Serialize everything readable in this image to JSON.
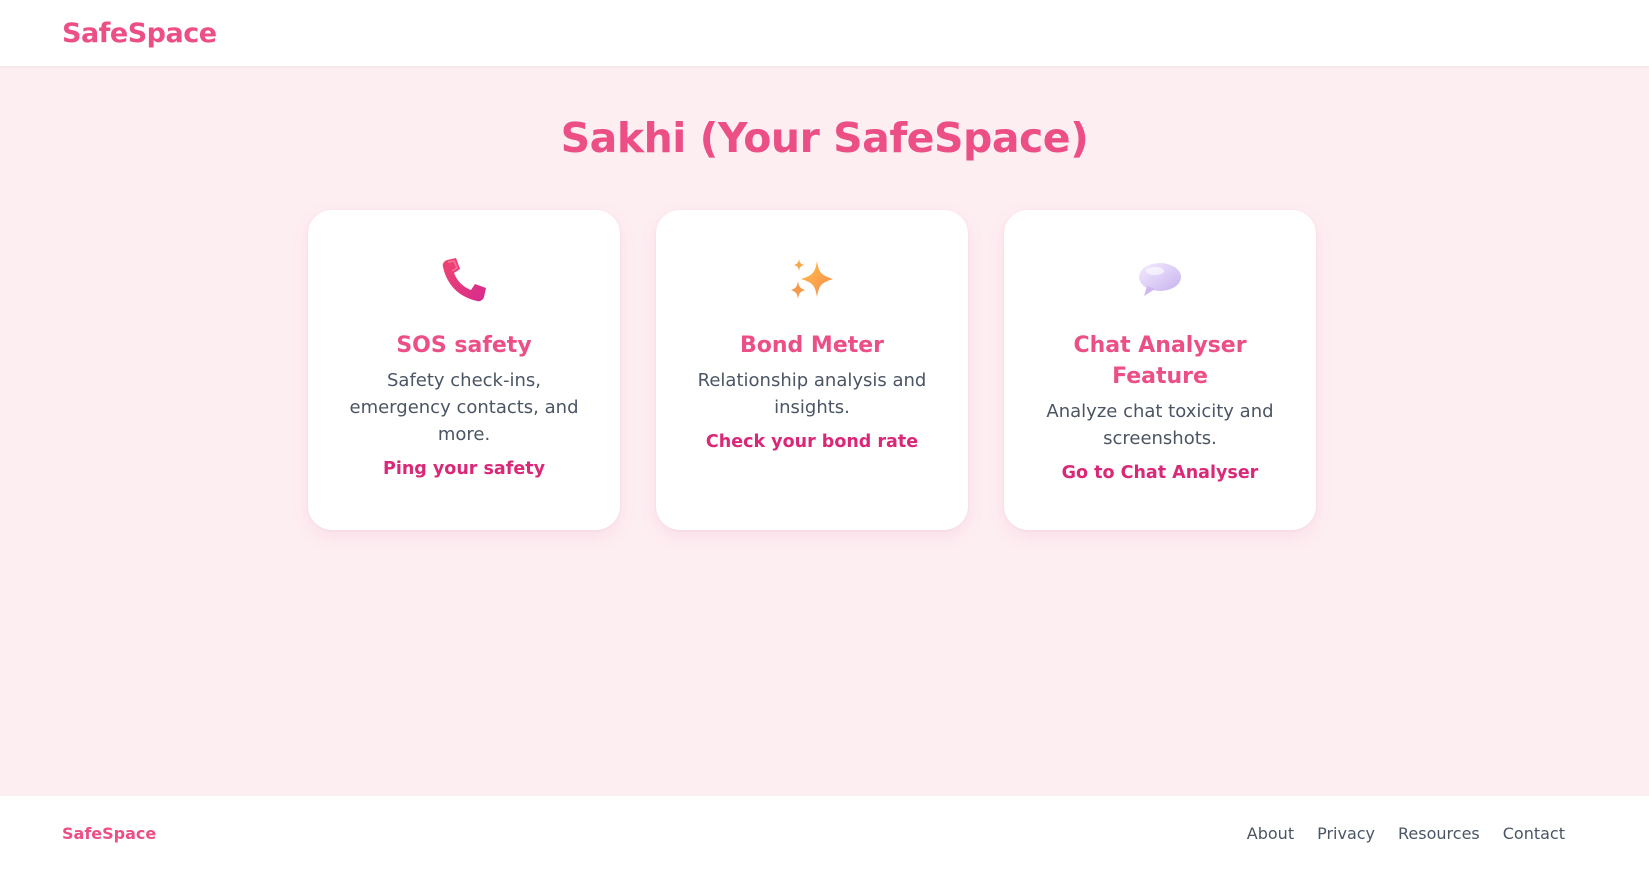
{
  "header": {
    "brand": "SafeSpace"
  },
  "main": {
    "title": "Sakhi (Your SafeSpace)",
    "cards": [
      {
        "icon": "telephone-receiver-icon",
        "title": "SOS safety",
        "description": "Safety check-ins, emergency contacts, and more.",
        "link": "Ping your safety"
      },
      {
        "icon": "sparkles-icon",
        "title": "Bond Meter",
        "description": "Relationship analysis and insights.",
        "link": "Check your bond rate"
      },
      {
        "icon": "speech-balloon-icon",
        "title": "Chat Analyser Feature",
        "description": "Analyze chat toxicity and screenshots.",
        "link": "Go to Chat Analyser"
      }
    ]
  },
  "footer": {
    "brand": "SafeSpace",
    "links": [
      "About",
      "Privacy",
      "Resources",
      "Contact"
    ]
  },
  "colors": {
    "accent": "#ec4f86",
    "link": "#db2777",
    "background": "#fdeef2",
    "text": "#4b5563"
  }
}
